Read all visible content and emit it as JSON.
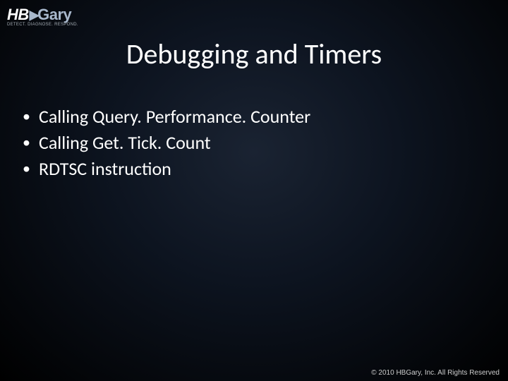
{
  "logo": {
    "hb": "HB",
    "gary": "Gary",
    "tagline": "DETECT. DIAGNOSE. RESPOND."
  },
  "slide": {
    "title": "Debugging and Timers",
    "bullets": [
      "Calling Query. Performance. Counter",
      "Calling Get. Tick. Count",
      "RDTSC instruction"
    ]
  },
  "footer": {
    "copyright": "© 2010 HBGary, Inc. All Rights Reserved"
  }
}
